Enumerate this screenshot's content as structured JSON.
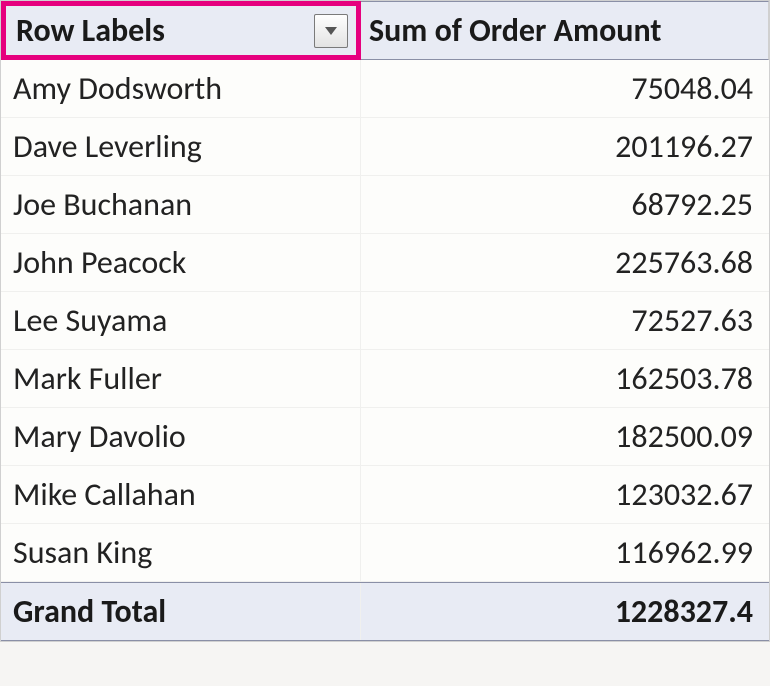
{
  "header": {
    "row_labels": "Row Labels",
    "sum_col": "Sum of Order Amount"
  },
  "rows": [
    {
      "name": "Amy Dodsworth",
      "value": "75048.04"
    },
    {
      "name": "Dave Leverling",
      "value": "201196.27"
    },
    {
      "name": "Joe Buchanan",
      "value": "68792.25"
    },
    {
      "name": "John Peacock",
      "value": "225763.68"
    },
    {
      "name": "Lee Suyama",
      "value": "72527.63"
    },
    {
      "name": "Mark Fuller",
      "value": "162503.78"
    },
    {
      "name": "Mary Davolio",
      "value": "182500.09"
    },
    {
      "name": "Mike Callahan",
      "value": "123032.67"
    },
    {
      "name": "Susan King",
      "value": "116962.99"
    }
  ],
  "grand": {
    "label": "Grand Total",
    "value": "1228327.4"
  },
  "highlight": {
    "color": "#e6007e"
  }
}
